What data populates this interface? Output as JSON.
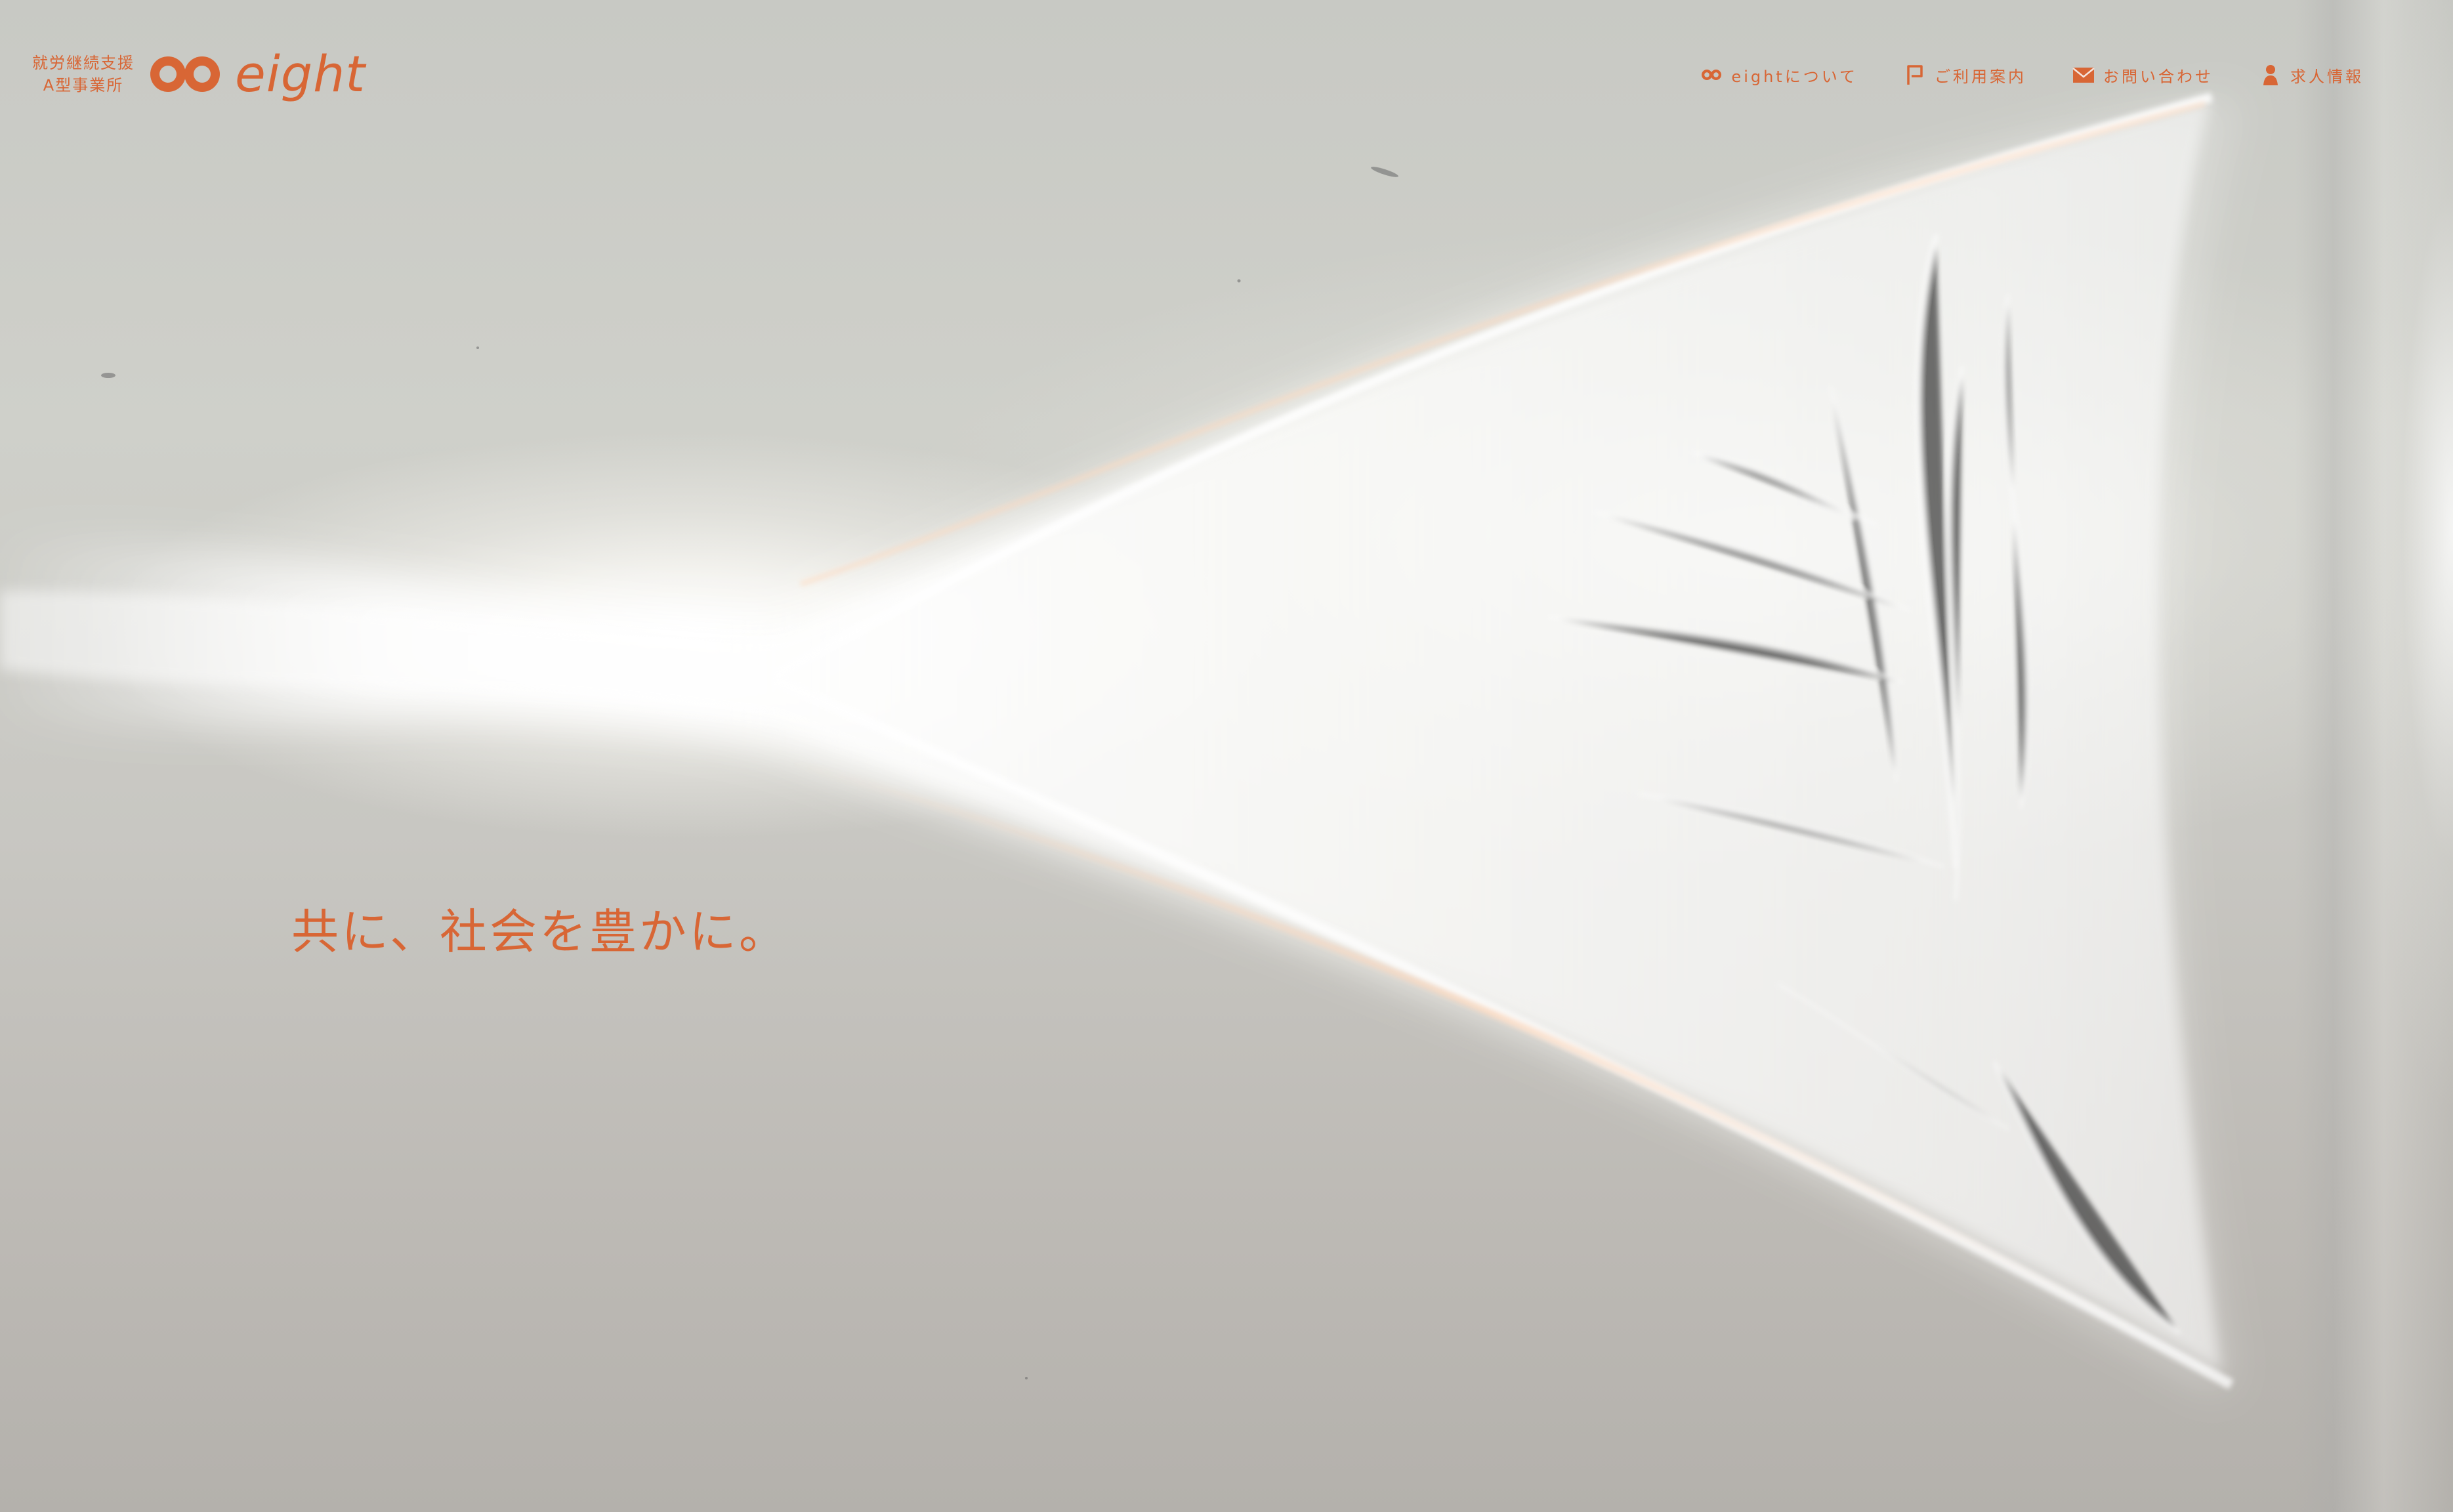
{
  "brand": {
    "service_type_line1": "就労継続支援",
    "service_type_line2": "A型事業所",
    "name": "eight"
  },
  "navigation": [
    {
      "label": "eightについて",
      "icon": "infinity-icon"
    },
    {
      "label": "ご利用案内",
      "icon": "flag-icon"
    },
    {
      "label": "お問い合わせ",
      "icon": "mail-icon"
    },
    {
      "label": "求人情報",
      "icon": "person-icon"
    }
  ],
  "hero": {
    "tagline": "共に、社会を豊かに。"
  },
  "colors": {
    "accent": "#d86635",
    "background": "#c8c9c4",
    "light": "#ffffff"
  }
}
